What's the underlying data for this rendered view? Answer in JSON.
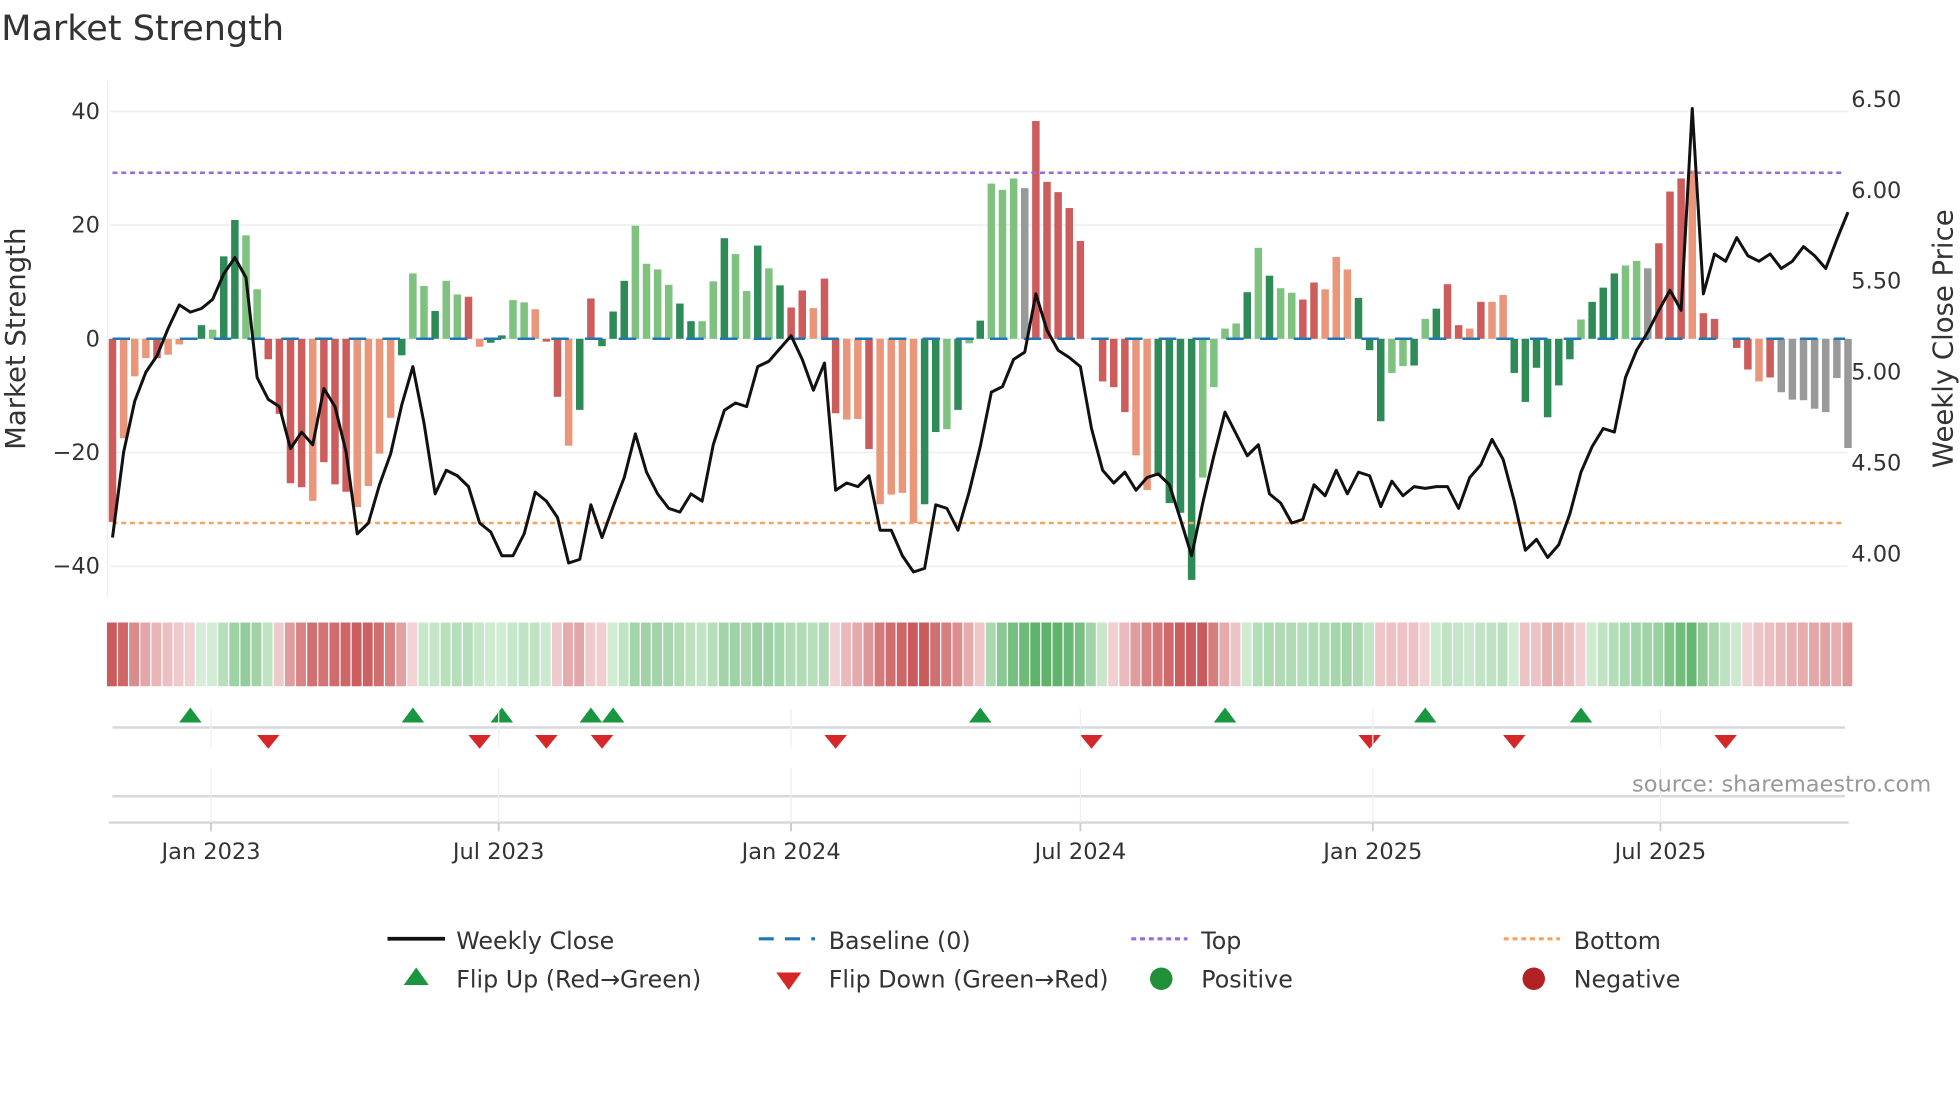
{
  "chart_data": {
    "type": "bar",
    "title": "Market Strength",
    "ylabel": "Market Strength",
    "ylabel_right": "Weekly Close Price",
    "ylim": [
      -45.5,
      45.3
    ],
    "ylim_right": [
      3.76,
      6.6
    ],
    "yticks": [
      40,
      20,
      0,
      -20,
      -40
    ],
    "yticks_labels": [
      "40",
      "20",
      "0",
      "−20",
      "−40"
    ],
    "yticks_right": [
      6.5,
      6.0,
      5.5,
      5.0,
      4.5,
      4.0
    ],
    "yticks_right_labels": [
      "6.50",
      "6.00",
      "5.50",
      "5.00",
      "4.50",
      "4.00"
    ],
    "x_start": "2022-10-31",
    "x_step_days": 7,
    "xticks": [
      {
        "date": "2023-01-01",
        "label": "Jan 2023"
      },
      {
        "date": "2023-07-01",
        "label": "Jul 2023"
      },
      {
        "date": "2024-01-01",
        "label": "Jan 2024"
      },
      {
        "date": "2024-07-01",
        "label": "Jul 2024"
      },
      {
        "date": "2025-01-01",
        "label": "Jan 2025"
      },
      {
        "date": "2025-07-01",
        "label": "Jul 2025"
      }
    ],
    "grid": true,
    "top_level": 29.2,
    "bottom_level": -32.4,
    "baseline": 0,
    "strength": [
      -32.2,
      -17.5,
      -6.6,
      -3.4,
      -3.4,
      -2.8,
      -1,
      0,
      2.4,
      1.6,
      14.5,
      20.9,
      18.2,
      8.7,
      -3.6,
      -13.2,
      -25.4,
      -26.1,
      -28.5,
      -21.7,
      -25.6,
      -26.9,
      -29.6,
      -25.9,
      -20.2,
      -13.9,
      -2.9,
      11.5,
      9.3,
      4.9,
      10.2,
      7.8,
      7.4,
      -1.4,
      -0.7,
      0.6,
      6.8,
      6.4,
      5.2,
      -0.5,
      -10.2,
      -18.8,
      -12.5,
      7.1,
      -1.3,
      4.8,
      10.2,
      19.9,
      13.2,
      12.2,
      9.5,
      6.2,
      3.1,
      3.1,
      10.1,
      17.7,
      14.9,
      8.4,
      16.4,
      12.4,
      9.4,
      5.5,
      8.5,
      5.4,
      10.6,
      -13.1,
      -14.2,
      -14.1,
      -19.4,
      -29.1,
      -27.4,
      -27.1,
      -32.4,
      -29.1,
      -16.4,
      -15.9,
      -12.5,
      -0.8,
      3.2,
      27.3,
      26.2,
      28.2,
      26.5,
      38.3,
      27.6,
      25.8,
      23.0,
      17.2,
      0,
      -7.5,
      -8.5,
      -12.9,
      -20.5,
      -26.6,
      -23.9,
      -28.9,
      -30.6,
      -42.4,
      -24.4,
      -8.5,
      1.8,
      2.7,
      8.2,
      16.0,
      11.1,
      8.9,
      8.1,
      6.9,
      9.9,
      8.7,
      14.4,
      12.2,
      7.2,
      -2.0,
      -14.5,
      -6.0,
      -4.8,
      -4.7,
      3.5,
      5.3,
      9.6,
      2.4,
      1.8,
      6.5,
      6.5,
      7.7,
      -6.0,
      -11.1,
      -5.1,
      -13.8,
      -8.2,
      -3.6,
      3.4,
      6.5,
      9.0,
      11.5,
      12.9,
      13.7,
      12.4,
      16.8,
      25.9,
      28.2,
      29.6,
      4.5,
      3.5,
      0,
      -1.6,
      -5.4,
      -7.5,
      -6.8,
      -9.4,
      -10.7,
      -10.8,
      -12.3,
      -12.9,
      -6.9,
      -19.2
    ],
    "strength_tone": "RrrrRrr.GgGGggRRRRrRRRrrrrGggGggRrGGggrRRrGRGGGggggGGggGggGgGRRrRRrrRrrrrGGgGgGggg.RRRRRrRRRrrGGGGggggGgGggRRrrrGGGggGgGRRrRrrGGGGGGgGGGgg.RRRrRRRRRrR",
    "weekly_close": [
      4.09,
      4.56,
      4.84,
      5.0,
      5.09,
      5.24,
      5.37,
      5.33,
      5.35,
      5.4,
      5.54,
      5.63,
      5.52,
      4.97,
      4.85,
      4.81,
      4.58,
      4.67,
      4.6,
      4.91,
      4.81,
      4.56,
      4.11,
      4.17,
      4.38,
      4.55,
      4.82,
      5.03,
      4.72,
      4.33,
      4.46,
      4.43,
      4.37,
      4.17,
      4.12,
      3.99,
      3.99,
      4.11,
      4.34,
      4.29,
      4.2,
      3.95,
      3.97,
      4.27,
      4.09,
      4.26,
      4.42,
      4.66,
      4.45,
      4.33,
      4.25,
      4.23,
      4.33,
      4.29,
      4.6,
      4.79,
      4.83,
      4.81,
      5.03,
      5.06,
      5.13,
      5.2,
      5.07,
      4.9,
      5.05,
      4.35,
      4.39,
      4.37,
      4.43,
      4.13,
      4.13,
      3.99,
      3.9,
      3.92,
      4.27,
      4.25,
      4.13,
      4.34,
      4.59,
      4.89,
      4.92,
      5.07,
      5.11,
      5.43,
      5.23,
      5.12,
      5.08,
      5.03,
      4.69,
      4.46,
      4.39,
      4.45,
      4.35,
      4.42,
      4.44,
      4.38,
      4.19,
      3.99,
      4.28,
      4.54,
      4.78,
      4.66,
      4.54,
      4.6,
      4.33,
      4.28,
      4.17,
      4.19,
      4.38,
      4.32,
      4.46,
      4.33,
      4.45,
      4.43,
      4.26,
      4.4,
      4.32,
      4.37,
      4.36,
      4.37,
      4.37,
      4.25,
      4.42,
      4.49,
      4.63,
      4.52,
      4.29,
      4.02,
      4.08,
      3.98,
      4.05,
      4.22,
      4.45,
      4.59,
      4.69,
      4.67,
      4.97,
      5.12,
      5.22,
      5.34,
      5.45,
      5.34,
      6.45,
      5.43,
      5.65,
      5.61,
      5.74,
      5.64,
      5.61,
      5.65,
      5.57,
      5.61,
      5.69,
      5.64,
      5.57,
      5.73,
      5.88
    ],
    "flip_up_weeks": [
      7,
      27,
      35,
      43,
      45,
      78,
      100,
      118,
      132
    ],
    "flip_down_weeks": [
      14,
      33,
      39,
      44,
      65,
      88,
      113,
      126,
      145
    ],
    "legend_position": "bottom",
    "colors": {
      "strong_positive": "#2e8b57",
      "weak_positive": "#7fc17f",
      "strong_negative": "#cd5c5c",
      "weak_negative": "#e9967a",
      "weekly_close": "#111111",
      "baseline": "#1f77b4",
      "top": "#9b6bd6",
      "bottom": "#f4a460",
      "flip_up": "#1a9641",
      "flip_down": "#d62728",
      "positive": "#1f8f3a",
      "negative": "#b22222"
    }
  },
  "legend": {
    "weekly_close": "Weekly Close",
    "baseline": "Baseline (0)",
    "top": "Top",
    "bottom": "Bottom",
    "flip_up": "Flip Up (Red→Green)",
    "flip_down": "Flip Down (Green→Red)",
    "positive": "Positive",
    "negative": "Negative"
  },
  "source": "source: sharemaestro.com"
}
